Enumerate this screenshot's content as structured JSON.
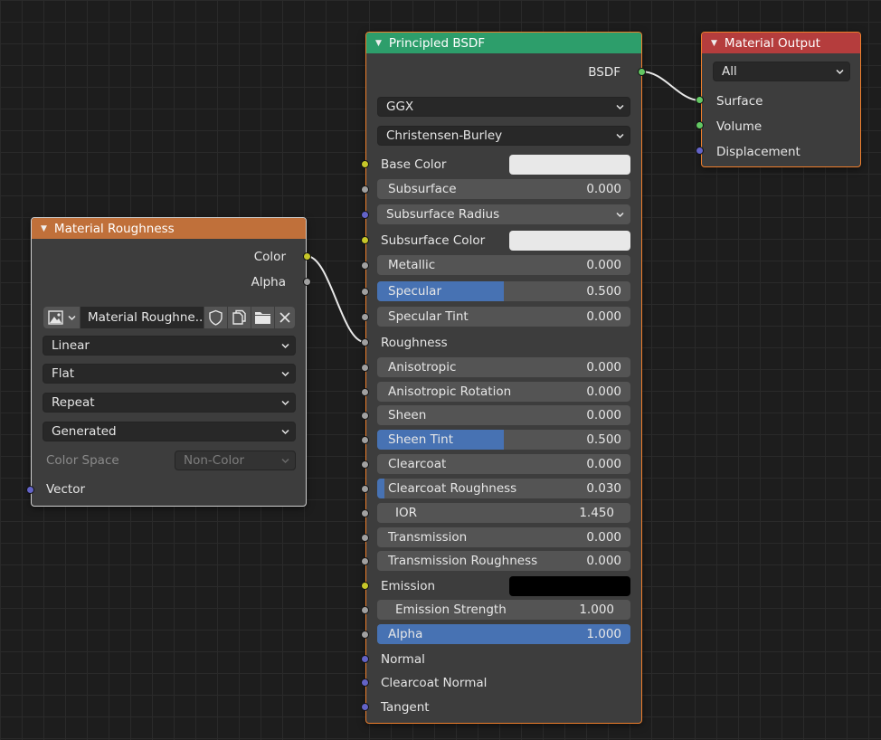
{
  "colors": {
    "header_output": "#b53d3d",
    "header_bsdf": "#2d9e6b",
    "header_texture": "#c0703a",
    "socket_color": "#c7c729",
    "socket_float": "#a1a1a1",
    "socket_vector": "#6363c7",
    "socket_shader": "#63c763",
    "slider_fill": "#4772b3",
    "selection_outline": "#ef7f2c"
  },
  "texture_node": {
    "title": "Material Roughness",
    "outputs": [
      "Color",
      "Alpha"
    ],
    "image_name": "Material Roughne...",
    "image_icons": [
      "image-icon",
      "shield-icon",
      "duplicate-icon",
      "folder-icon",
      "close-icon"
    ],
    "interpolation": "Linear",
    "projection": "Flat",
    "extension": "Repeat",
    "source": "Generated",
    "color_space_label": "Color Space",
    "color_space_value": "Non-Color",
    "input_vector": "Vector"
  },
  "bsdf_node": {
    "title": "Principled BSDF",
    "output": "BSDF",
    "distribution": "GGX",
    "subsurface_method": "Christensen-Burley",
    "base_color": {
      "label": "Base Color",
      "swatch": "#e8e8e8"
    },
    "subsurface": {
      "label": "Subsurface",
      "value": "0.000",
      "fraction": 0
    },
    "subsurface_radius": "Subsurface Radius",
    "subsurface_color": {
      "label": "Subsurface Color",
      "swatch": "#e8e8e8"
    },
    "metallic": {
      "label": "Metallic",
      "value": "0.000",
      "fraction": 0
    },
    "specular": {
      "label": "Specular",
      "value": "0.500",
      "fraction": 0.5
    },
    "specular_tint": {
      "label": "Specular Tint",
      "value": "0.000",
      "fraction": 0
    },
    "roughness": "Roughness",
    "anisotropic": {
      "label": "Anisotropic",
      "value": "0.000",
      "fraction": 0
    },
    "anisotropic_rotation": {
      "label": "Anisotropic Rotation",
      "value": "0.000",
      "fraction": 0
    },
    "sheen": {
      "label": "Sheen",
      "value": "0.000",
      "fraction": 0
    },
    "sheen_tint": {
      "label": "Sheen Tint",
      "value": "0.500",
      "fraction": 0.5
    },
    "clearcoat": {
      "label": "Clearcoat",
      "value": "0.000",
      "fraction": 0
    },
    "clearcoat_roughness": {
      "label": "Clearcoat Roughness",
      "value": "0.030",
      "fraction": 0.03
    },
    "ior": {
      "label": "IOR",
      "value": "1.450"
    },
    "transmission": {
      "label": "Transmission",
      "value": "0.000",
      "fraction": 0
    },
    "transmission_roughness": {
      "label": "Transmission Roughness",
      "value": "0.000",
      "fraction": 0
    },
    "emission": {
      "label": "Emission",
      "swatch": "#000000"
    },
    "emission_strength": {
      "label": "Emission Strength",
      "value": "1.000"
    },
    "alpha": {
      "label": "Alpha",
      "value": "1.000",
      "fraction": 1
    },
    "normal": "Normal",
    "clearcoat_normal": "Clearcoat Normal",
    "tangent": "Tangent"
  },
  "output_node": {
    "title": "Material Output",
    "target": "All",
    "inputs": [
      "Surface",
      "Volume",
      "Displacement"
    ]
  }
}
